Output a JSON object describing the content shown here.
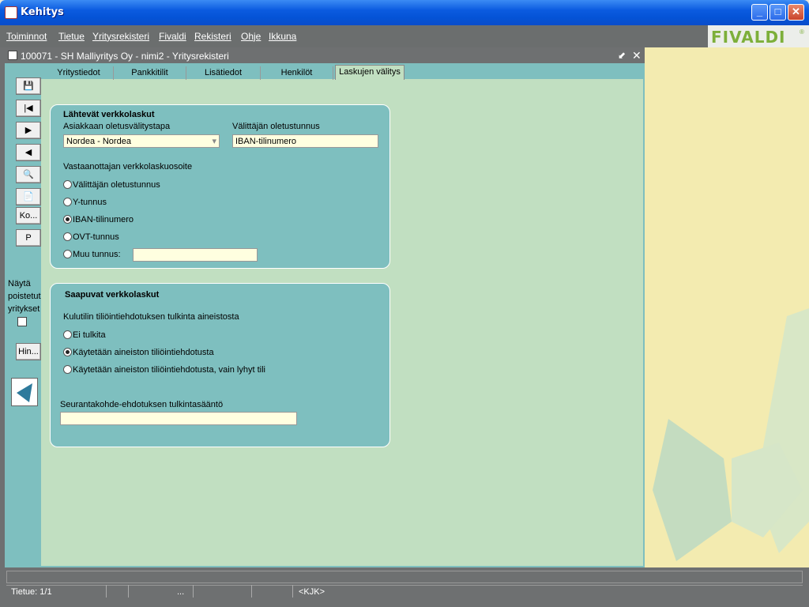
{
  "window": {
    "title": "Kehitys"
  },
  "menu": [
    "Toiminnot",
    "Tietue",
    "Yritysrekisteri",
    "Fivaldi",
    "Rekisteri",
    "Ohje",
    "Ikkuna"
  ],
  "logo": "FIVALDI",
  "logo_mark": "®",
  "form": {
    "title": "100071 - SH Malliyritys Oy - nimi2 - Yritysrekisteri",
    "tabs": [
      "Yritystiedot",
      "Pankkitilit",
      "Lisätiedot",
      "Henkilöt",
      "Laskujen välitys"
    ],
    "active_tab": "Laskujen välitys"
  },
  "toolbar": {
    "ko_label": "Ko...",
    "p_label": "P",
    "show_deleted_label_1": "Näytä",
    "show_deleted_label_2": "poistetut",
    "show_deleted_label_3": "yritykset",
    "hin_label": "Hin..."
  },
  "outgoing": {
    "title": "Lähtevät verkkolaskut",
    "customer_method_label": "Asiakkaan oletusvälitystapa",
    "customer_method_value": "Nordea - Nordea",
    "broker_id_label": "Välittäjän oletustunnus",
    "broker_id_value": "IBAN-tilinumero",
    "recipient_address_label": "Vastaanottajan verkkolaskuosoite",
    "options": [
      "Välittäjän oletustunnus",
      "Y-tunnus",
      "IBAN-tilinumero",
      "OVT-tunnus",
      "Muu tunnus:"
    ],
    "selected": "IBAN-tilinumero",
    "other_value": ""
  },
  "incoming": {
    "title": "Saapuvat verkkolaskut",
    "interpretation_label": "Kulutilin tiliöintiehdotuksen tulkinta aineistosta",
    "options": [
      "Ei tulkita",
      "Käytetään aineiston tiliöintiehdotusta",
      "Käytetään aineiston tiliöintiehdotusta, vain lyhyt tili"
    ],
    "selected": "Käytetään aineiston tiliöintiehdotusta",
    "tracking_rule_label": "Seurantakohde-ehdotuksen tulkintasääntö",
    "tracking_rule_value": ""
  },
  "status": {
    "record": "Tietue: 1/1",
    "ellipsis": "...",
    "user": "<KJK>"
  }
}
